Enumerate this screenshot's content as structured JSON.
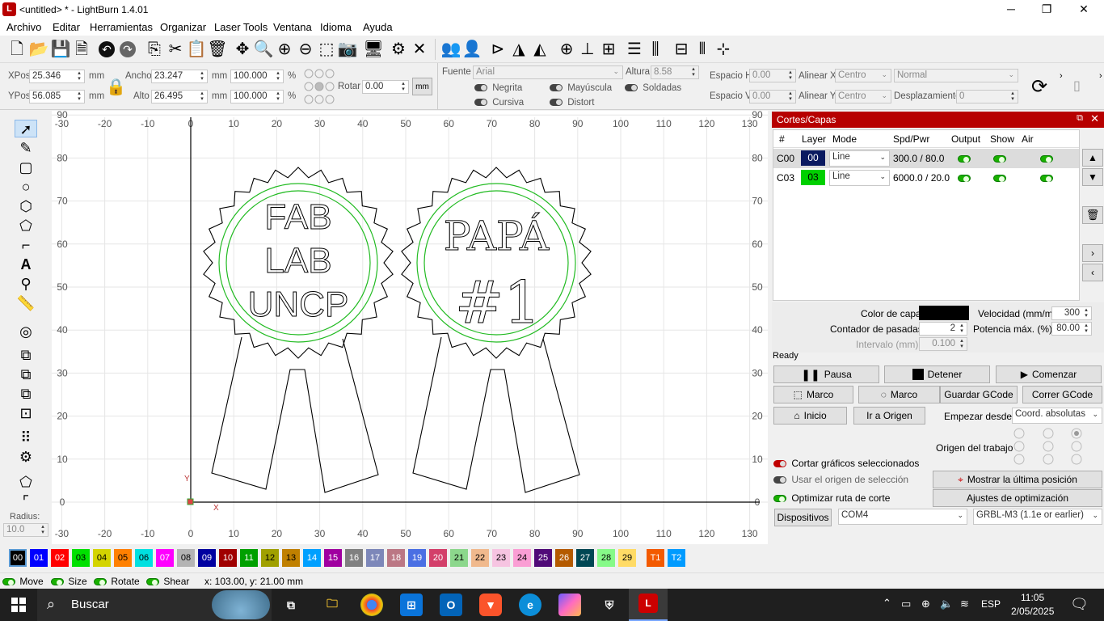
{
  "window": {
    "title": "<untitled> * - LightBurn 1.4.01",
    "min": "─",
    "max": "❐",
    "close": "✕"
  },
  "menu": [
    "Archivo",
    "Editar",
    "Herramientas",
    "Organizar",
    "Laser Tools",
    "Ventana",
    "Idioma",
    "Ayuda"
  ],
  "props": {
    "xpos_label": "XPos",
    "xpos": "25.346",
    "ypos_label": "YPos",
    "ypos": "56.085",
    "unit": "mm",
    "width_label": "Ancho",
    "width": "23.247",
    "height_label": "Alto",
    "height": "26.495",
    "scale_w": "100.000",
    "scale_h": "100.000",
    "pct": "%",
    "rotate_label": "Rotar",
    "rotate": "0.00",
    "mm_btn": "mm"
  },
  "font": {
    "font_label": "Fuente",
    "font": "Arial",
    "height_label": "Altura",
    "height": "8.58",
    "bold": "Negrita",
    "italic": "Cursiva",
    "upper": "Mayúscula",
    "distort": "Distort",
    "welded": "Soldadas",
    "hspace_label": "Espacio H",
    "hspace": "0.00",
    "vspace_label": "Espacio V",
    "vspace": "0.00",
    "alignx_label": "Alinear X",
    "alignx": "Centro",
    "aligny_label": "Alinear Y",
    "aligny": "Centro",
    "normal": "Normal",
    "offset_label": "Desplazamiento",
    "offset": "0"
  },
  "ruler": {
    "x_labels": [
      "-30",
      "-20",
      "-10",
      "0",
      "10",
      "20",
      "30",
      "40",
      "50",
      "60",
      "70",
      "80",
      "90",
      "100",
      "110",
      "120",
      "130"
    ],
    "y_labels": [
      "90",
      "80",
      "70",
      "60",
      "50",
      "40",
      "30",
      "20",
      "10",
      "0"
    ],
    "origin_x": "X",
    "origin_y": "Y"
  },
  "design": {
    "left_text": [
      "FAB",
      "LAB",
      "UNCP"
    ],
    "right_text": [
      "PAPÁ",
      "#1"
    ]
  },
  "radius": {
    "label": "Radius:",
    "value": "10.0"
  },
  "cuts": {
    "title": "Cortes/Capas",
    "cols": [
      "#",
      "Layer",
      "Mode",
      "Spd/Pwr",
      "Output",
      "Show",
      "Air"
    ],
    "rows": [
      {
        "id": "C00",
        "layer": "00",
        "mode": "Line",
        "sp": "300.0 / 80.0",
        "color": "#000080"
      },
      {
        "id": "C03",
        "layer": "03",
        "mode": "Line",
        "sp": "6000.0 / 20.0",
        "color": "#00c000"
      }
    ],
    "layer_color_label": "Color de capa",
    "layer_color": "#000000",
    "speed_label": "Velocidad (mm/m)",
    "speed": "300",
    "passes_label": "Contador de pasadas",
    "passes": "2",
    "power_label": "Potencia máx. (%)",
    "power": "80.00",
    "interval_label": "Intervalo (mm)",
    "interval": "0.100"
  },
  "laser": {
    "status": "Ready",
    "pause": "Pausa",
    "stop": "Detener",
    "start": "Comenzar",
    "frame1": "Marco",
    "frame2": "Marco",
    "save_gcode": "Guardar GCode",
    "run_gcode": "Correr GCode",
    "home": "Inicio",
    "go_origin": "Ir a Origen",
    "start_from_label": "Empezar desde:",
    "start_from": "Coord. absolutas",
    "job_origin_label": "Origen del trabajo",
    "cut_selected": "Cortar gráficos seleccionados",
    "use_sel_origin": "Usar el origen de selección",
    "optimize": "Optimizar ruta de corte",
    "show_last": "Mostrar la última posición",
    "opt_settings": "Ajustes de optimización",
    "devices": "Dispositivos",
    "port": "COM4",
    "device": "GRBL-M3 (1.1e or earlier)"
  },
  "palette": [
    {
      "n": "00",
      "c": "#000000",
      "t": "#fff"
    },
    {
      "n": "01",
      "c": "#0000ff",
      "t": "#fff"
    },
    {
      "n": "02",
      "c": "#ff0000",
      "t": "#fff"
    },
    {
      "n": "03",
      "c": "#00e000",
      "t": "#000"
    },
    {
      "n": "04",
      "c": "#d4d400",
      "t": "#000"
    },
    {
      "n": "05",
      "c": "#ff8000",
      "t": "#000"
    },
    {
      "n": "06",
      "c": "#00e0e0",
      "t": "#000"
    },
    {
      "n": "07",
      "c": "#ff00ff",
      "t": "#fff"
    },
    {
      "n": "08",
      "c": "#b4b4b4",
      "t": "#000"
    },
    {
      "n": "09",
      "c": "#0000a0",
      "t": "#fff"
    },
    {
      "n": "10",
      "c": "#a00000",
      "t": "#fff"
    },
    {
      "n": "11",
      "c": "#00a000",
      "t": "#fff"
    },
    {
      "n": "12",
      "c": "#a0a000",
      "t": "#000"
    },
    {
      "n": "13",
      "c": "#c08000",
      "t": "#000"
    },
    {
      "n": "14",
      "c": "#00a0ff",
      "t": "#fff"
    },
    {
      "n": "15",
      "c": "#a000a0",
      "t": "#fff"
    },
    {
      "n": "16",
      "c": "#808080",
      "t": "#fff"
    },
    {
      "n": "17",
      "c": "#7d87b9",
      "t": "#fff"
    },
    {
      "n": "18",
      "c": "#bb7784",
      "t": "#fff"
    },
    {
      "n": "19",
      "c": "#4a6fe3",
      "t": "#fff"
    },
    {
      "n": "20",
      "c": "#d33f6a",
      "t": "#fff"
    },
    {
      "n": "21",
      "c": "#8cd78c",
      "t": "#000"
    },
    {
      "n": "22",
      "c": "#f0b98d",
      "t": "#000"
    },
    {
      "n": "23",
      "c": "#f6c4e1",
      "t": "#000"
    },
    {
      "n": "24",
      "c": "#fa9ed4",
      "t": "#000"
    },
    {
      "n": "25",
      "c": "#500a78",
      "t": "#fff"
    },
    {
      "n": "26",
      "c": "#b45a00",
      "t": "#fff"
    },
    {
      "n": "27",
      "c": "#004754",
      "t": "#fff"
    },
    {
      "n": "28",
      "c": "#86fa88",
      "t": "#000"
    },
    {
      "n": "29",
      "c": "#ffdb66",
      "t": "#000"
    },
    {
      "n": "T1",
      "c": "#f35a00",
      "t": "#fff"
    },
    {
      "n": "T2",
      "c": "#009bff",
      "t": "#fff"
    }
  ],
  "status": {
    "move": "Move",
    "size": "Size",
    "rotate": "Rotate",
    "shear": "Shear",
    "coords": "x: 103.00, y: 21.00 mm"
  },
  "taskbar": {
    "search": "Buscar",
    "lang": "ESP",
    "time": "11:05",
    "date": "2/05/2025"
  }
}
